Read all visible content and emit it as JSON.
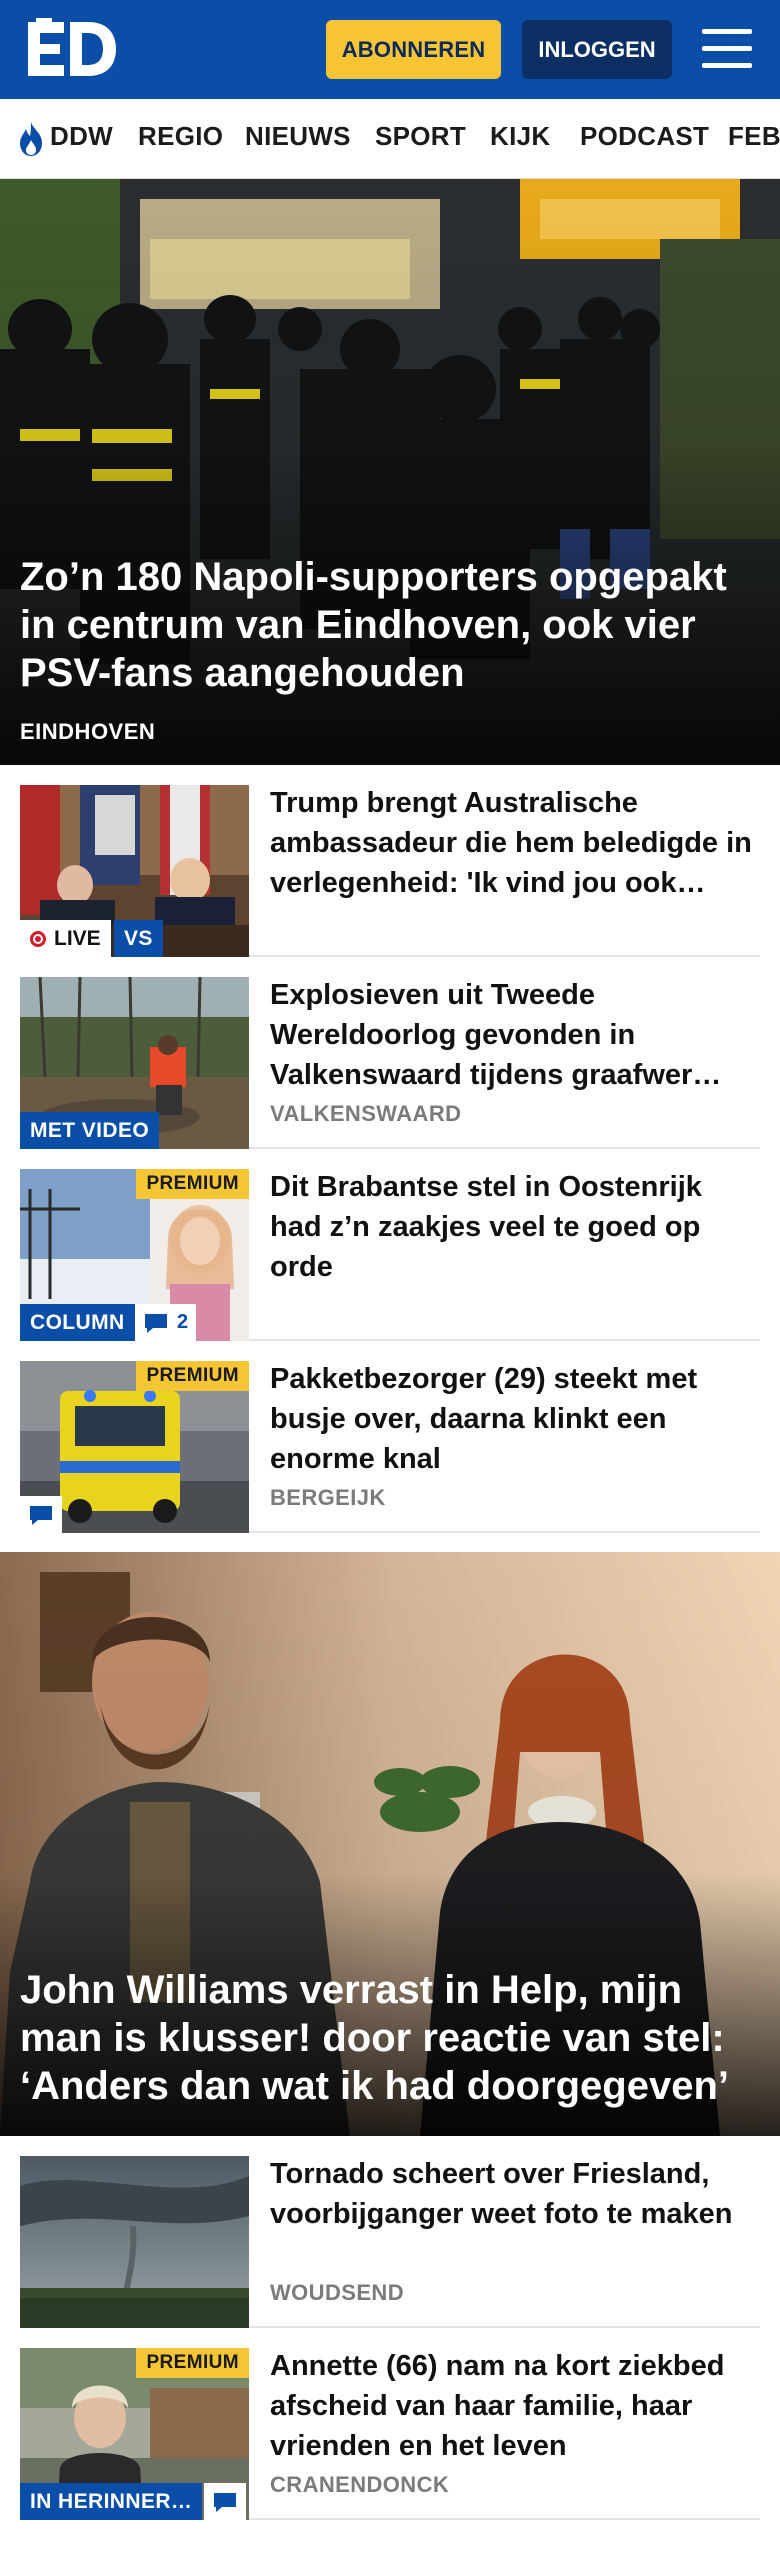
{
  "header": {
    "logo_text": "ED",
    "subscribe_label": "ABONNEREN",
    "login_label": "INLOGGEN",
    "menu_icon": "hamburger-icon",
    "brand_color": "#0a4ea8",
    "accent_color": "#f7c433"
  },
  "nav": {
    "items": [
      "DDW",
      "REGIO",
      "NIEUWS",
      "SPORT",
      "KIJK",
      "PODCAST",
      "FEB"
    ],
    "first_item_icon": "flame-icon"
  },
  "hero": {
    "title": "Zo’n 180 Napoli-supporters opgepakt in centrum van Eindhoven, ook vier PSV-fans aangehouden",
    "kicker": "EINDHOVEN"
  },
  "articles": [
    {
      "title": "Trump brengt Australische ambassadeur die hem beledigde in verlegenheid: 'Ik vind jou ook…",
      "kicker": "",
      "live_label": "LIVE",
      "tag_label": "VS"
    },
    {
      "title": "Explosieven uit Tweede Wereldoorlog gevonden in Valkenswaard tijdens graafwer…",
      "kicker": "VALKENSWAARD",
      "tag_label": "MET VIDEO"
    },
    {
      "title": "Dit Brabantse stel in Oostenrijk had z’n zaakjes veel te goed op orde",
      "kicker": "",
      "premium_label": "PREMIUM",
      "tag_label": "COLUMN",
      "comment_count": "2"
    },
    {
      "title": "Pakketbezorger (29) steekt met busje over, daarna klinkt een enorme knal",
      "kicker": "BERGEIJK",
      "premium_label": "PREMIUM"
    }
  ],
  "feature": {
    "title": "John Williams verrast in Help, mijn man is klusser! door reactie van stel: ‘Anders dan wat ik had doorgegeven’"
  },
  "articles_bottom": [
    {
      "title": "Tornado scheert over Friesland, voorbijganger weet foto te maken",
      "kicker": "WOUDSEND"
    },
    {
      "title": "Annette (66) nam na kort ziekbed afscheid van haar familie, haar vrienden en het leven",
      "kicker": "CRANENDONCK",
      "premium_label": "PREMIUM",
      "tag_label": "IN HERINNER…"
    }
  ]
}
